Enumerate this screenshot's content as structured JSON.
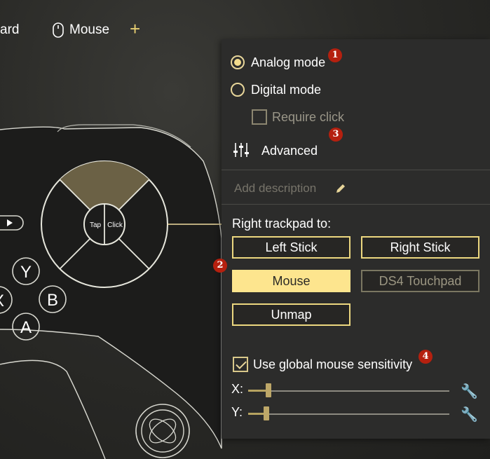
{
  "tabs": {
    "keyboard_partial": "ard",
    "mouse": "Mouse",
    "add": "+"
  },
  "controller": {
    "trackpad_tap": "Tap",
    "trackpad_click": "Click",
    "buttons": {
      "y": "Y",
      "x": "X",
      "b": "B",
      "a": "A"
    }
  },
  "panel": {
    "analog_mode": "Analog mode",
    "digital_mode": "Digital mode",
    "require_click": "Require click",
    "advanced": "Advanced",
    "description_placeholder": "Add description",
    "trackpad_heading": "Right trackpad to:",
    "buttons": {
      "left_stick": "Left Stick",
      "right_stick": "Right Stick",
      "mouse": "Mouse",
      "ds4_touchpad": "DS4 Touchpad",
      "unmap": "Unmap"
    },
    "global_sensitivity": "Use global mouse sensitivity",
    "x_label": "X:",
    "y_label": "Y:",
    "x_slider_level": 0.1,
    "y_slider_level": 0.09
  },
  "badges": {
    "one": "1",
    "two": "2",
    "three": "3",
    "four": "4"
  },
  "colors": {
    "accent": "#fde58e",
    "badge": "#b5200f",
    "panel_bg": "#2c2c2b",
    "controller_outline": "#d8d8d0"
  }
}
